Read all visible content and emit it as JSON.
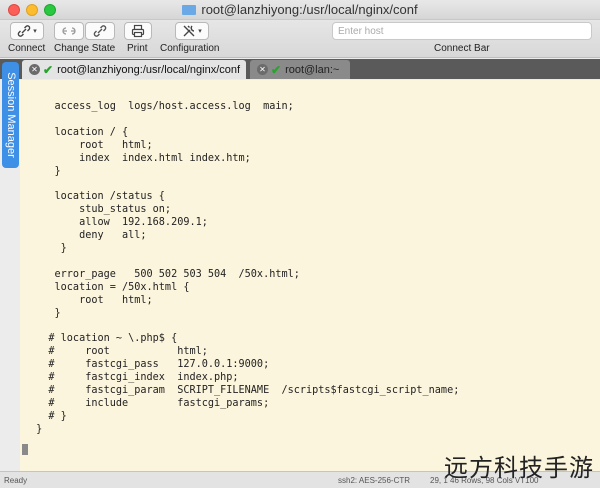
{
  "window": {
    "title": "root@lanzhiyong:/usr/local/nginx/conf"
  },
  "toolbar": {
    "connect_label": "Connect",
    "change_state_label": "Change State",
    "print_label": "Print",
    "configuration_label": "Configuration",
    "host_placeholder": "Enter host",
    "connect_bar_label": "Connect Bar"
  },
  "tabs": [
    {
      "label": "root@lanzhiyong:/usr/local/nginx/conf",
      "active": true
    },
    {
      "label": "root@lan:~",
      "active": false
    }
  ],
  "sidebar": {
    "session_manager_label": "Session Manager"
  },
  "terminal": {
    "content": "    access_log  logs/host.access.log  main;\n\n    location / {\n        root   html;\n        index  index.html index.htm;\n    }\n\n    location /status {\n        stub_status on;\n        allow  192.168.209.1;\n        deny   all;\n     }\n\n    error_page   500 502 503 504  /50x.html;\n    location = /50x.html {\n        root   html;\n    }\n\n   # location ~ \\.php$ {\n   #     root           html;\n   #     fastcgi_pass   127.0.0.1:9000;\n   #     fastcgi_index  index.php;\n   #     fastcgi_param  SCRIPT_FILENAME  /scripts$fastcgi_script_name;\n   #     include        fastcgi_params;\n   # }\n }"
  },
  "statusbar": {
    "left": "Ready",
    "mid": "ssh2: AES-256-CTR",
    "right": "29, 1  46 Rows, 98 Cols  VT100"
  },
  "watermark": "远方科技手游",
  "colors": {
    "terminal_bg": "#fcf5dd",
    "session_manager": "#3e8fe6",
    "tab_check": "#29a22f"
  }
}
